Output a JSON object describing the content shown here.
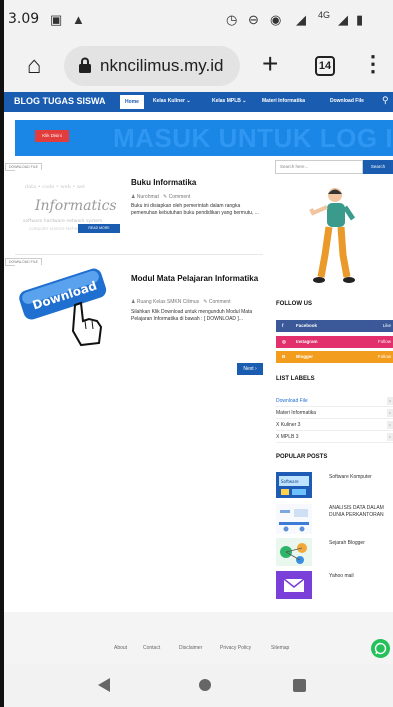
{
  "status": {
    "time": "3.09",
    "network": "4G"
  },
  "browser": {
    "url": "nkncilimus.my.id",
    "tab_count": "14"
  },
  "nav": {
    "site_title": "BLOG TUGAS SISWA",
    "items": [
      "Home",
      "Kelas Kuliner",
      "Kelas MPLB",
      "Materi Informatika",
      "Download File"
    ]
  },
  "banner": {
    "button": "Klik Disini",
    "text": "MASUK UNTUK LOG IN"
  },
  "posts": [
    {
      "tag": "DOWNLOAD FILE",
      "title": "Buku Informatika",
      "author": "Nurohmat",
      "comments": "Comment",
      "excerpt": "Buku ini disiapkan oleh pemerintah dalam rangka pemenuhan kebutuhan buku pendidikan yang bermutu, ...",
      "thumb_word": "Informatics",
      "thumb_button": "READ MORE"
    },
    {
      "tag": "DOWNLOAD FILE",
      "title": "Modul Mata Pelajaran Informatika",
      "author": "Ruang Kelas SMKN Cilimus",
      "comments": "Comment",
      "excerpt": "Silahkan Klik Download untuk mengunduh Modul Mata Pelajaran Informatika di bawah : [ DOWNLOAD ]...",
      "thumb_word": "Download"
    }
  ],
  "pagination": {
    "next": "Next ›"
  },
  "sidebar": {
    "search_placeholder": "Search here...",
    "search_button": "Search",
    "follow_title": "FOLLOW US",
    "follow": [
      {
        "icon": "f",
        "name": "Facebook",
        "action": "Like",
        "color": "#3b5998"
      },
      {
        "icon": "◎",
        "name": "Instagram",
        "action": "Follow",
        "color": "#e1306c"
      },
      {
        "icon": "B",
        "name": "Blogger",
        "action": "Follow",
        "color": "#f29d1d"
      }
    ],
    "labels_title": "LIST LABELS",
    "labels": [
      {
        "name": "Download File",
        "count": "2"
      },
      {
        "name": "Materi Informatika",
        "count": "1"
      },
      {
        "name": "X Kuliner 3",
        "count": "1"
      },
      {
        "name": "X MPLB 3",
        "count": "1"
      }
    ],
    "popular_title": "POPULAR POSTS",
    "popular": [
      {
        "title": "Software Komputer"
      },
      {
        "title": "ANALISIS DATA DALAM DUNIA PERKANTORAN"
      },
      {
        "title": "Sejarah Blogger"
      },
      {
        "title": "Yahoo mail"
      }
    ]
  },
  "footer": {
    "links": [
      "About",
      "Contact",
      "Disclaimer",
      "Privacy Policy",
      "Sitemap"
    ]
  },
  "colors": {
    "primary": "#1a5cb0",
    "banner": "#1a86e6",
    "accent_red": "#e23c3c",
    "whatsapp": "#25c05a"
  }
}
